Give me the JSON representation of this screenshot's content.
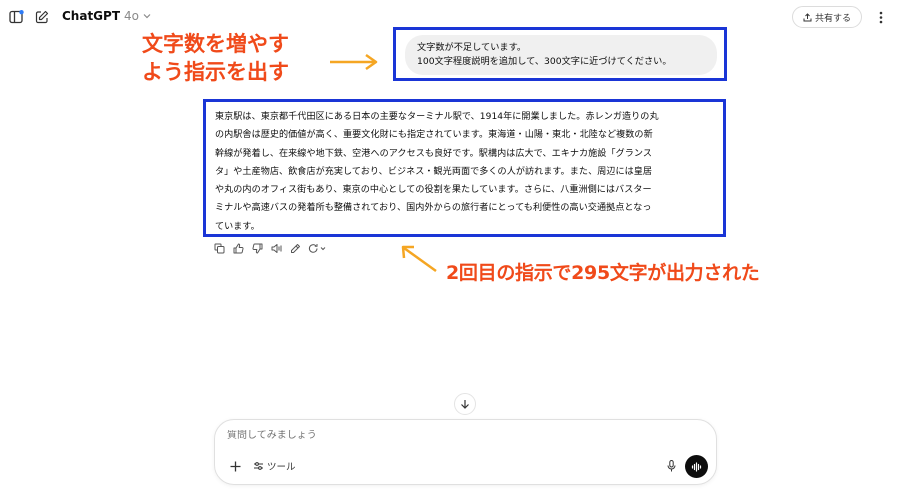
{
  "header": {
    "model_name": "ChatGPT",
    "model_version": "4o",
    "share_label": "共有する"
  },
  "annotations": {
    "left_line1": "文字数を増やす",
    "left_line2": "よう指示を出す",
    "bottom": "2回目の指示で295文字が出力された",
    "color": "#f04a1a",
    "frame_color": "#1a35d6"
  },
  "user_message": {
    "line1": "文字数が不足しています。",
    "line2": "100文字程度説明を追加して、300文字に近づけてください。"
  },
  "assistant_message": {
    "lines": [
      "東京駅は、東京都千代田区にある日本の主要なターミナル駅で、1914年に開業しました。赤レンガ造りの丸",
      "の内駅舎は歴史的価値が高く、重要文化財にも指定されています。東海道・山陽・東北・北陸など複数の新",
      "幹線が発着し、在来線や地下鉄、空港へのアクセスも良好です。駅構内は広大で、エキナカ施設「グランス",
      "タ」や土産物店、飲食店が充実しており、ビジネス・観光両面で多くの人が訪れます。また、周辺には皇居",
      "や丸の内のオフィス街もあり、東京の中心としての役割を果たしています。さらに、八重洲側にはバスター",
      "ミナルや高速バスの発着所も整備されており、国内外からの旅行者にとっても利便性の高い交通拠点となっ",
      "ています。"
    ]
  },
  "composer": {
    "placeholder": "質問してみましょう",
    "tools_label": "ツール"
  },
  "icons": {
    "sidebar": "sidebar-toggle-icon",
    "new_chat": "edit-icon",
    "share": "share-icon",
    "more": "more-vertical-icon",
    "copy": "copy-icon",
    "thumbs_up": "thumbs-up-icon",
    "thumbs_down": "thumbs-down-icon",
    "read_aloud": "speaker-icon",
    "edit": "pen-icon",
    "regenerate": "refresh-icon",
    "scroll": "arrow-down-icon",
    "plus": "plus-icon",
    "tools": "tools-icon",
    "mic": "mic-icon",
    "voice": "voice-wave-icon"
  }
}
